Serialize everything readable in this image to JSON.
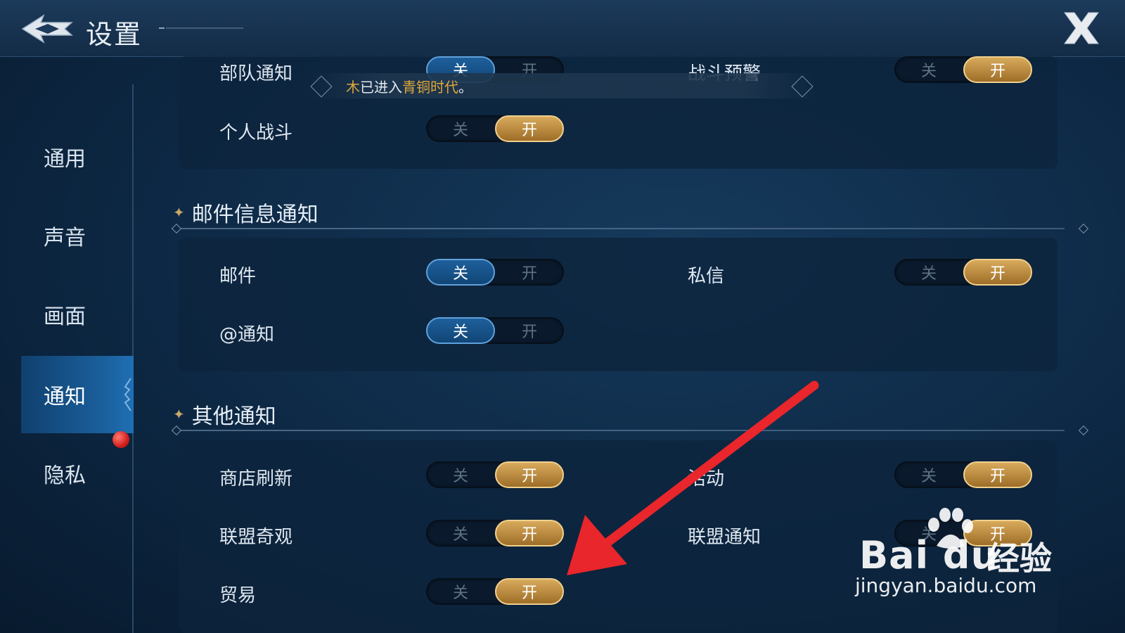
{
  "header": {
    "title": "设置"
  },
  "sidebar": {
    "items": [
      {
        "label": "通用",
        "active": false
      },
      {
        "label": "声音",
        "active": false
      },
      {
        "label": "画面",
        "active": false
      },
      {
        "label": "通知",
        "active": true
      },
      {
        "label": "隐私",
        "active": false
      }
    ]
  },
  "toggle_labels": {
    "off": "关",
    "on": "开"
  },
  "banner": {
    "part1": "木",
    "part2": "已进入",
    "part3": "青铜时代",
    "part4": "。"
  },
  "sections": {
    "top": {
      "rows": [
        {
          "label": "部队通知",
          "state": "off"
        },
        {
          "label": "战斗预警",
          "state": "on"
        },
        {
          "label": "个人战斗",
          "state": "on"
        }
      ]
    },
    "mail": {
      "title": "邮件信息通知",
      "rows": [
        {
          "label": "邮件",
          "state": "off"
        },
        {
          "label": "私信",
          "state": "on"
        },
        {
          "label": "@通知",
          "state": "off"
        }
      ]
    },
    "other": {
      "title": "其他通知",
      "rows": [
        {
          "label": "商店刷新",
          "state": "on"
        },
        {
          "label": "活动",
          "state": "on"
        },
        {
          "label": "联盟奇观",
          "state": "on"
        },
        {
          "label": "联盟通知",
          "state": "on"
        },
        {
          "label": "贸易",
          "state": "on"
        }
      ]
    }
  },
  "watermark": {
    "brand": "Bai du",
    "suffix": "经验",
    "url": "jingyan.baidu.com"
  },
  "colors": {
    "accent_gold": "#d8aa5c",
    "accent_blue": "#1e5f9c",
    "annotation_red": "#e8262b"
  }
}
